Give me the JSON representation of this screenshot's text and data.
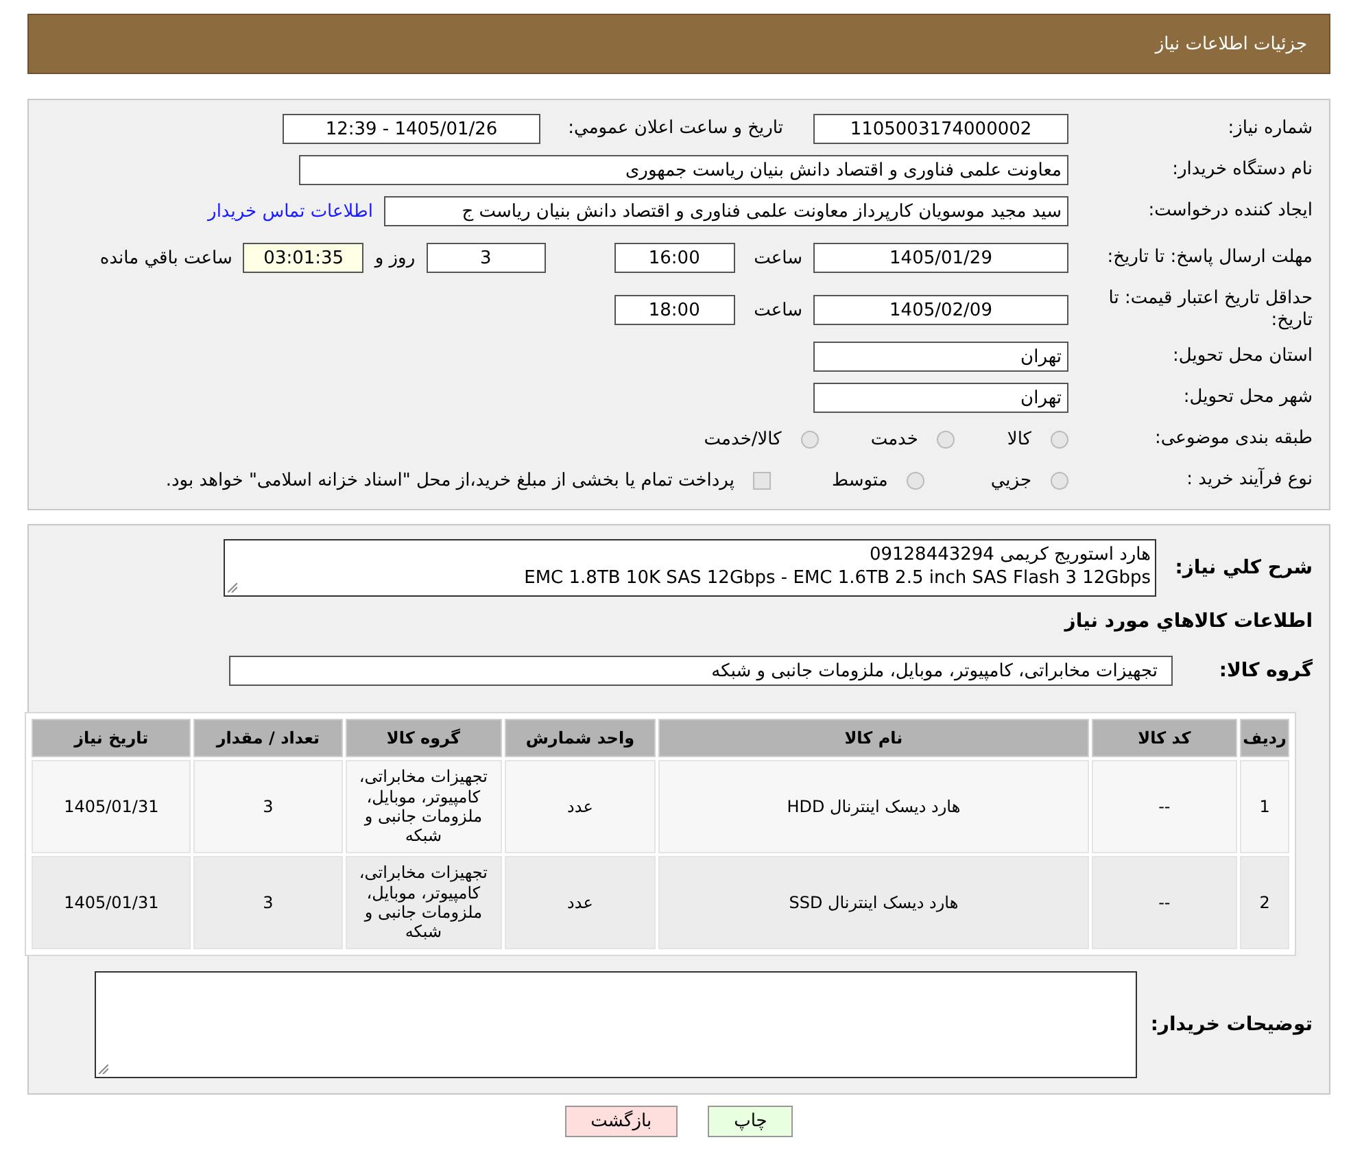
{
  "header": {
    "title": "جزئیات اطلاعات نیاز"
  },
  "need_number": {
    "label": "شماره نیاز:",
    "value": "1105003174000002"
  },
  "announce": {
    "label": "تاریخ و ساعت اعلان عمومي:",
    "value": "1405/01/26 - 12:39"
  },
  "buyer": {
    "label": "نام دستگاه خریدار:",
    "value": "معاونت علمی فناوری و اقتصاد دانش بنیان ریاست جمهوری"
  },
  "requester": {
    "label": "ایجاد کننده درخواست:",
    "value": "سید مجید موسویان کارپرداز معاونت علمی فناوری و اقتصاد دانش بنیان ریاست ج",
    "link": "اطلاعات تماس خریدار"
  },
  "deadline": {
    "label": "مهلت ارسال پاسخ: تا تاریخ:",
    "date": "1405/01/29",
    "time_label": "ساعت",
    "time": "16:00",
    "days": "3",
    "days_label": "روز و",
    "remaining": "03:01:35",
    "remaining_label": "ساعت باقي مانده"
  },
  "validity": {
    "label": "حداقل تاریخ اعتبار قیمت: تا تاریخ:",
    "date": "1405/02/09",
    "time_label": "ساعت",
    "time": "18:00"
  },
  "province": {
    "label": "استان محل تحویل:",
    "value": "تهران"
  },
  "city": {
    "label": "شهر محل تحویل:",
    "value": "تهران"
  },
  "category": {
    "label": "طبقه بندی موضوعی:",
    "options": [
      {
        "label": "کالا",
        "selected": false
      },
      {
        "label": "خدمت",
        "selected": false
      },
      {
        "label": "کالا/خدمت",
        "selected": false
      }
    ]
  },
  "process": {
    "label": "نوع فرآیند خرید :",
    "options": [
      {
        "label": "جزيي",
        "selected": false,
        "kind": "radio"
      },
      {
        "label": "متوسط",
        "selected": false,
        "kind": "radio"
      },
      {
        "label": "پرداخت تمام یا بخشی از مبلغ خرید،از محل \"اسناد خزانه اسلامی\" خواهد بود.",
        "selected": false,
        "kind": "checkbox"
      }
    ]
  },
  "description": {
    "label": "شرح كلي نياز:",
    "lines": [
      "هارد استوریج کریمی 09128443294",
      "EMC 1.8TB 10K SAS 12Gbps - EMC 1.6TB 2.5 inch SAS Flash 3 12Gbps"
    ]
  },
  "goods_heading": "اطلاعات كالاهاي مورد نياز",
  "goods_group": {
    "label": "گروه كالا:",
    "value": "تجهیزات مخابراتی، کامپیوتر، موبایل، ملزومات جانبی و شبکه"
  },
  "table": {
    "columns": [
      "ردیف",
      "کد کالا",
      "نام کالا",
      "واحد شمارش",
      "گروه کالا",
      "تعداد / مقدار",
      "تاریخ نیاز"
    ],
    "rows": [
      [
        "1",
        "--",
        "هارد دیسک اینترنال HDD",
        "عدد",
        "تجهیزات مخابراتی، کامپیوتر، موبایل، ملزومات جانبی و شبکه",
        "3",
        "1405/01/31"
      ],
      [
        "2",
        "--",
        "هارد دیسک اینترنال SSD",
        "عدد",
        "تجهیزات مخابراتی، کامپیوتر، موبایل، ملزومات جانبی و شبکه",
        "3",
        "1405/01/31"
      ]
    ]
  },
  "buyer_notes": {
    "label": "توضیحات خریدار:"
  },
  "buttons": [
    {
      "label": "چاپ",
      "kind": "print"
    },
    {
      "label": "بازگشت",
      "kind": "back"
    }
  ]
}
